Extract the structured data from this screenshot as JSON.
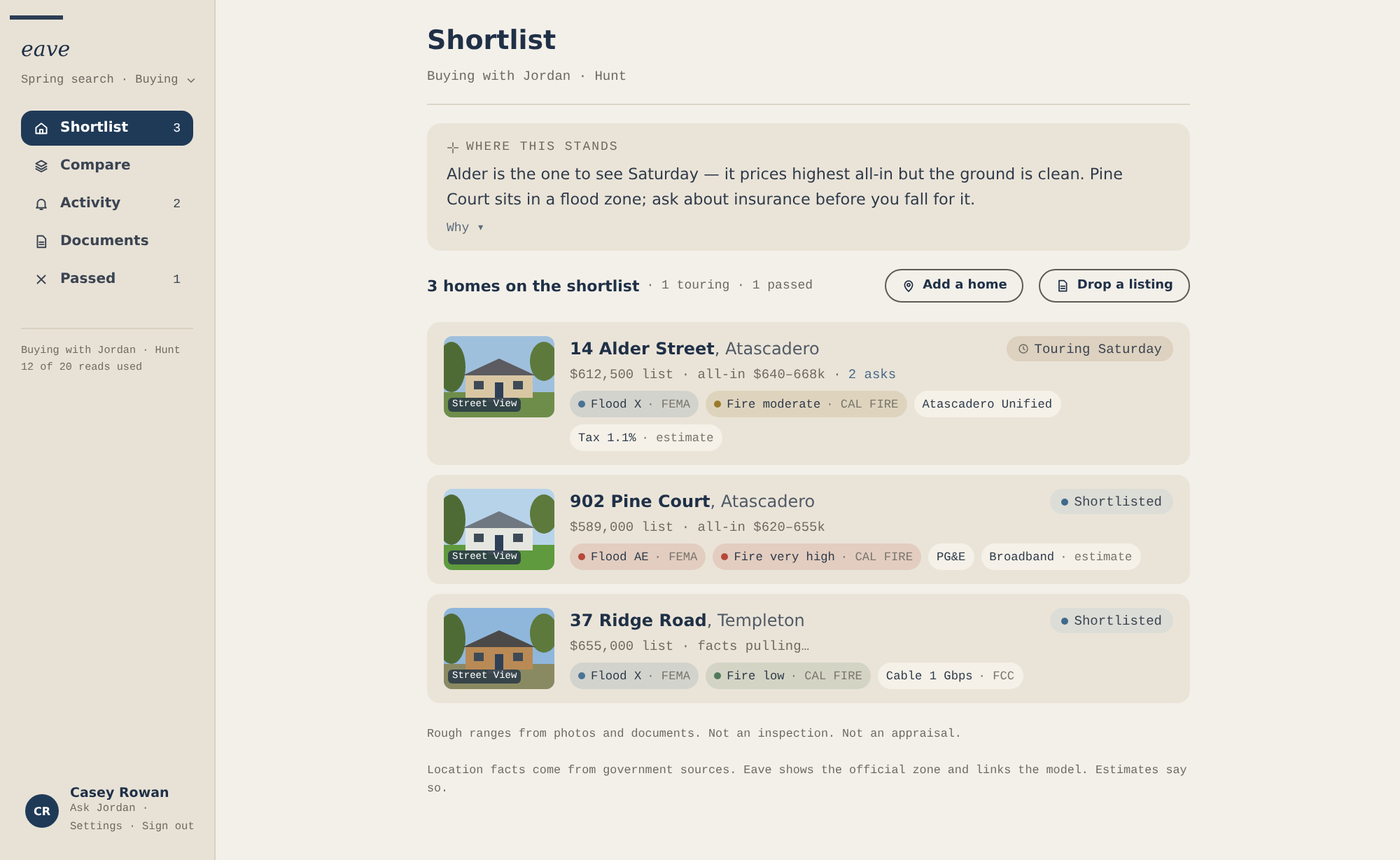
{
  "sidebar": {
    "logo": "eave",
    "workspace": "Spring search · Buying",
    "items": [
      {
        "label": "Shortlist",
        "count": "3",
        "selected": true
      },
      {
        "label": "Compare",
        "selected": false
      },
      {
        "label": "Activity",
        "count": "2",
        "selected": false
      },
      {
        "label": "Documents",
        "selected": false
      },
      {
        "label": "Passed",
        "count": "1",
        "selected": false
      }
    ],
    "note": [
      "Buying with Jordan · Hunt",
      "12 of 20 reads used"
    ],
    "user": {
      "initials": "CR",
      "name": "Casey Rowan",
      "links": [
        "Ask Jordan ·",
        "Settings · Sign out"
      ]
    }
  },
  "header": {
    "title": "Shortlist",
    "subtitle": "Buying with Jordan · Hunt"
  },
  "summary": {
    "label": "WHERE THIS STANDS",
    "text": "Alder is the one to see Saturday — it prices highest all-in but the ground is clean. Pine Court sits in a flood zone; ask about insurance before you fall for it.",
    "toggle": "Why ▾"
  },
  "list_header": {
    "title": "3 homes on the shortlist",
    "meta": "· 1 touring · 1 passed"
  },
  "buttons": [
    {
      "label": "Add a home"
    },
    {
      "label": "Drop a listing"
    }
  ],
  "homes": [
    {
      "street": "14 Alder Street",
      "city": ", Atascadero",
      "details": "$612,500 list · all-in $640–668k ·",
      "link": "2 asks",
      "photo_label": "Street View",
      "status": {
        "kind": "touring",
        "label": "Touring Saturday"
      },
      "tags": [
        {
          "label": "Flood X",
          "source": "· FEMA",
          "color": "#4a7394"
        },
        {
          "label": "Fire moderate",
          "source": "· CAL FIRE",
          "color": "#9a7a2c"
        },
        {
          "label": "Atascadero Unified"
        },
        {
          "label": "Tax 1.1%",
          "source": "· estimate"
        }
      ]
    },
    {
      "street": "902 Pine Court",
      "city": ", Atascadero",
      "details": "$589,000 list · all-in $620–655k",
      "photo_label": "Street View",
      "status": {
        "kind": "shortlisted",
        "label": "Shortlisted"
      },
      "tags": [
        {
          "label": "Flood AE",
          "source": "· FEMA",
          "color": "#b5483a"
        },
        {
          "label": "Fire very high",
          "source": "· CAL FIRE",
          "color": "#b5483a"
        },
        {
          "label": "PG&E"
        },
        {
          "label": "Broadband",
          "source": "· estimate"
        }
      ]
    },
    {
      "street": "37 Ridge Road",
      "city": ", Templeton",
      "details": "$655,000 list · facts pulling…",
      "photo_label": "Street View",
      "status": {
        "kind": "shortlisted",
        "label": "Shortlisted"
      },
      "tags": [
        {
          "label": "Flood X",
          "source": "· FEMA",
          "color": "#4a7394"
        },
        {
          "label": "Fire low",
          "source": "· CAL FIRE",
          "color": "#4f7a5a"
        },
        {
          "label": "Cable 1 Gbps",
          "source": "· FCC"
        }
      ]
    }
  ],
  "notes": [
    "Rough ranges from photos and documents. Not an inspection. Not an appraisal.",
    "Location facts come from government sources. Eave shows the official zone and links the model. Estimates say so."
  ]
}
